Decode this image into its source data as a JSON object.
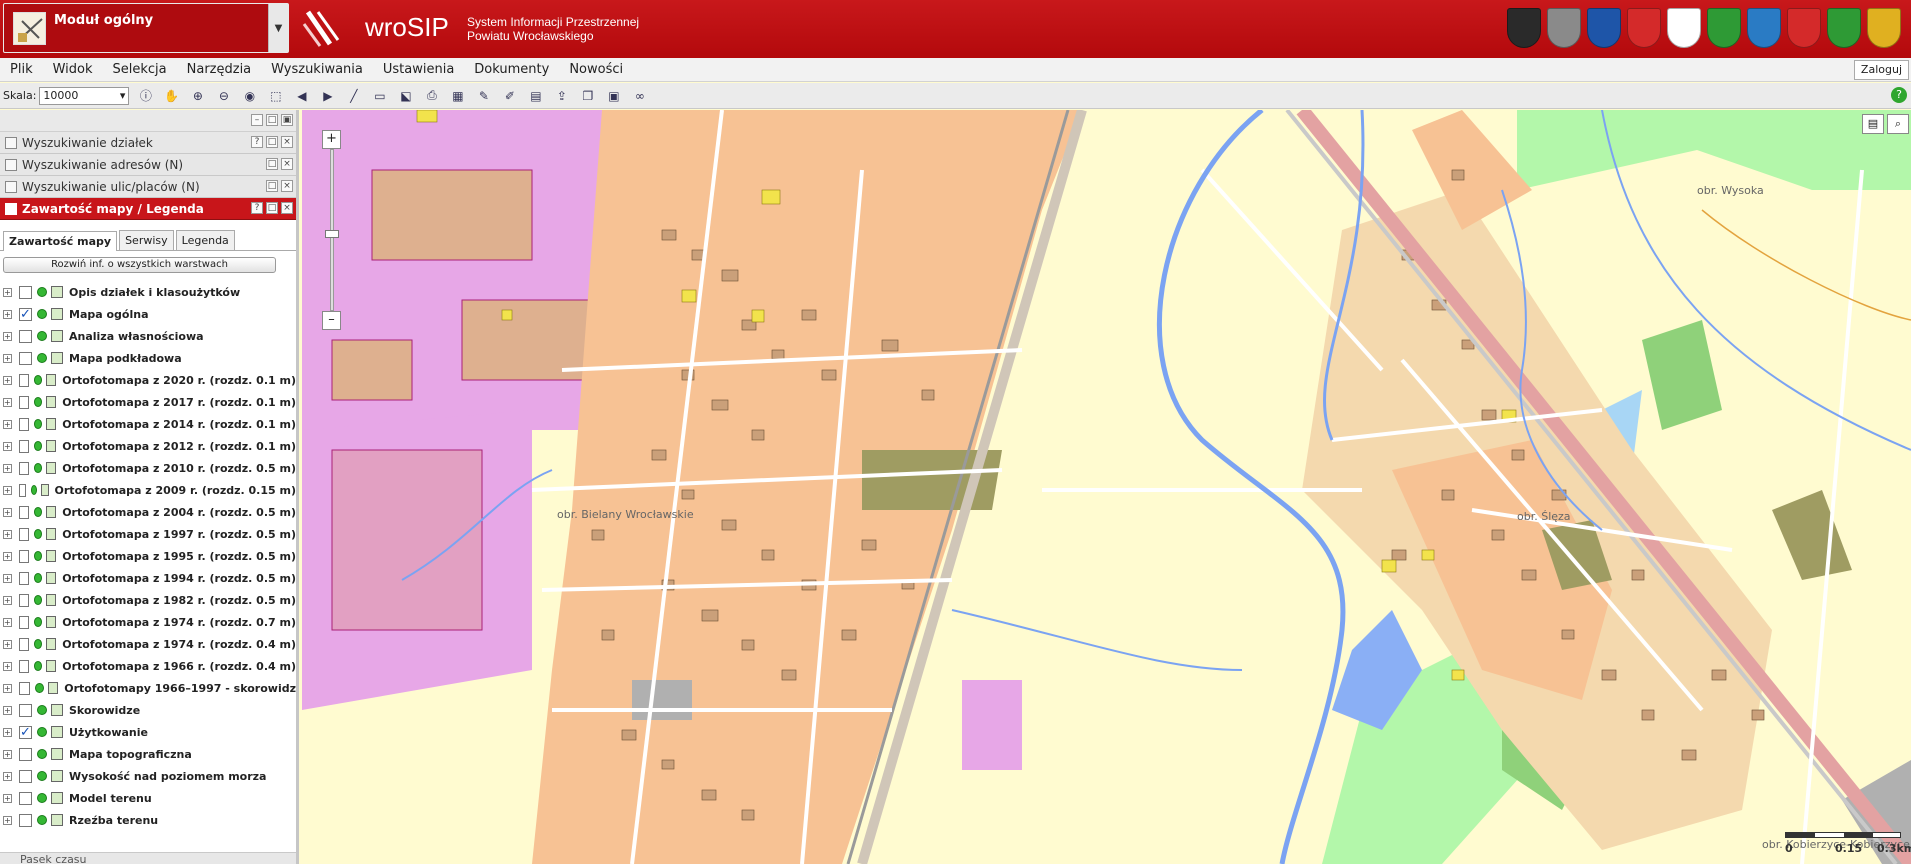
{
  "header": {
    "module_label": "Moduł ogólny",
    "brand_name": "wroSIP",
    "brand_sub_line1": "System Informacji Przestrzennej",
    "brand_sub_line2": "Powiatu Wrocławskiego",
    "crest_colors": [
      "#2a2a2a",
      "#8a8a8a",
      "#1e55a8",
      "#d42a2a",
      "#ffffff",
      "#2e9a35",
      "#2a7bc4",
      "#d42a2a",
      "#2e9a35",
      "#e0b020"
    ]
  },
  "menu": {
    "items": [
      "Plik",
      "Widok",
      "Selekcja",
      "Narzędzia",
      "Wyszukiwania",
      "Ustawienia",
      "Dokumenty",
      "Nowości"
    ],
    "login_label": "Zaloguj"
  },
  "toolbar": {
    "scale_label": "Skala:",
    "scale_value": "10000",
    "tools": [
      "info-icon",
      "pan-icon",
      "zoom-in-icon",
      "zoom-out-icon",
      "full-extent-icon",
      "zoom-box-icon",
      "back-arrow-icon",
      "forward-arrow-icon",
      "measure-line-icon",
      "measure-area-icon",
      "select-icon",
      "print-icon",
      "layers-icon",
      "edit-icon",
      "draw-icon",
      "table-icon",
      "export-icon",
      "copy-icon",
      "save-icon",
      "link-icon"
    ]
  },
  "sidebar": {
    "panels": [
      {
        "title": "Wyszukiwanie działek",
        "active": false
      },
      {
        "title": "Wyszukiwanie adresów (N)",
        "active": false
      },
      {
        "title": "Wyszukiwanie ulic/placów (N)",
        "active": false
      },
      {
        "title": "Zawartość mapy / Legenda",
        "active": true
      }
    ],
    "tabs": [
      "Zawartość mapy",
      "Serwisy",
      "Legenda"
    ],
    "expand_label": "Rozwiń inf. o wszystkich warstwach",
    "layers": [
      {
        "label": "Opis działek i klasoużytków",
        "checked": false
      },
      {
        "label": "Mapa ogólna",
        "checked": true
      },
      {
        "label": "Analiza własnościowa",
        "checked": false
      },
      {
        "label": "Mapa podkładowa",
        "checked": false
      },
      {
        "label": "Ortofotomapa z 2020 r. (rozdz. 0.1 m)",
        "checked": false
      },
      {
        "label": "Ortofotomapa z 2017 r. (rozdz. 0.1 m)",
        "checked": false
      },
      {
        "label": "Ortofotomapa z 2014 r. (rozdz. 0.1 m)",
        "checked": false
      },
      {
        "label": "Ortofotomapa z 2012 r. (rozdz. 0.1 m)",
        "checked": false
      },
      {
        "label": "Ortofotomapa z 2010 r. (rozdz. 0.5 m)",
        "checked": false
      },
      {
        "label": "Ortofotomapa z 2009 r. (rozdz. 0.15 m)",
        "checked": false
      },
      {
        "label": "Ortofotomapa z 2004 r. (rozdz. 0.5 m)",
        "checked": false
      },
      {
        "label": "Ortofotomapa z 1997 r. (rozdz. 0.5 m)",
        "checked": false
      },
      {
        "label": "Ortofotomapa z 1995 r. (rozdz. 0.5 m)",
        "checked": false
      },
      {
        "label": "Ortofotomapa z 1994 r. (rozdz. 0.5 m)",
        "checked": false
      },
      {
        "label": "Ortofotomapa z 1982 r. (rozdz. 0.5 m)",
        "checked": false
      },
      {
        "label": "Ortofotomapa z 1974 r. (rozdz. 0.7 m)",
        "checked": false
      },
      {
        "label": "Ortofotomapa z 1974 r. (rozdz. 0.4 m)",
        "checked": false
      },
      {
        "label": "Ortofotomapa z 1966 r. (rozdz. 0.4 m)",
        "checked": false
      },
      {
        "label": "Ortofotomapy 1966–1997 - skorowidz",
        "checked": false
      },
      {
        "label": "Skorowidze",
        "checked": false
      },
      {
        "label": "Użytkowanie",
        "checked": true
      },
      {
        "label": "Mapa topograficzna",
        "checked": false
      },
      {
        "label": "Wysokość nad poziomem morza",
        "checked": false
      },
      {
        "label": "Model terenu",
        "checked": false
      },
      {
        "label": "Rzeźba terenu",
        "checked": false
      }
    ],
    "bottom_panel_title": "Pasek czasu"
  },
  "map": {
    "labels": {
      "wysoka": "obr. Wysoka",
      "bielany": "obr. Bielany Wrocławskie",
      "sleza": "obr. Ślęza",
      "kosory": "obr. Kobierzyce-Kobierzyce"
    },
    "scalebar": {
      "l0": "0",
      "l1": "0.15",
      "l2": "0.3km"
    }
  }
}
